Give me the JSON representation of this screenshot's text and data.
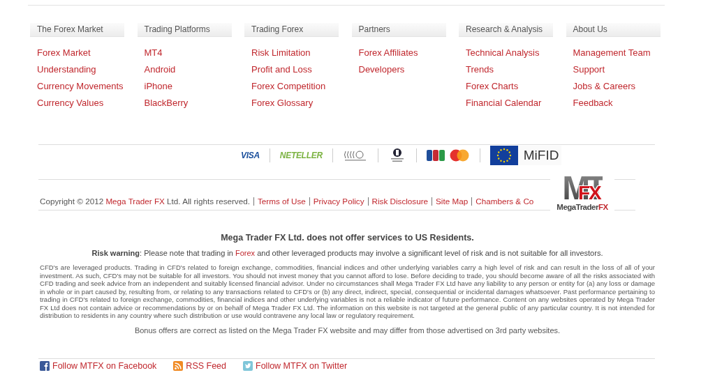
{
  "nav_columns": [
    {
      "heading": "The Forex Market",
      "links": [
        "Forex Market",
        "Understanding",
        "Currency Movements",
        "Currency Values"
      ]
    },
    {
      "heading": "Trading Platforms",
      "links": [
        "MT4",
        "Android",
        "iPhone",
        "BlackBerry"
      ]
    },
    {
      "heading": "Trading Forex",
      "links": [
        "Risk Limitation",
        "Profit and Loss",
        "Forex Competition",
        "Forex Glossary"
      ]
    },
    {
      "heading": "Partners",
      "links": [
        "Forex Affiliates",
        "Developers"
      ]
    },
    {
      "heading": "Research & Analysis",
      "links": [
        "Technical Analysis",
        "Trends",
        "Forex Charts",
        "Financial Calendar"
      ]
    },
    {
      "heading": "About Us",
      "links": [
        "Management Team",
        "Support",
        "Jobs & Careers",
        "Feedback"
      ]
    }
  ],
  "payment_logos": [
    {
      "kind": "wordmark",
      "text": "VISA",
      "color": "#1a4f9c"
    },
    {
      "kind": "wordmark",
      "text": "NETELLER",
      "color": "#7cb342"
    },
    {
      "kind": "rings"
    },
    {
      "kind": "disc"
    },
    {
      "kind": "tiles"
    },
    {
      "kind": "circles"
    },
    {
      "kind": "flag",
      "text": "MiFID"
    }
  ],
  "copyright": {
    "prefix": "Copyright © 2012 ",
    "company": "Mega Trader FX",
    "suffix": " Ltd. All rights reserved.",
    "links": [
      "Terms of Use",
      "Privacy Policy",
      "Risk Disclosure",
      "Site Map",
      "Chambers & Co"
    ]
  },
  "brand_logo": {
    "mark": "MT",
    "mark_accent": "FX",
    "wordmark": "MegaTrader",
    "wordmark_accent": "FX"
  },
  "us_notice": "Mega Trader FX Ltd. does not offer services to US Residents.",
  "risk_warning": {
    "label": "Risk warning",
    "before": ": Please note that trading in ",
    "link": "Forex",
    "after": " and other leveraged products may involve a significant level of risk and is not suitable for all investors."
  },
  "disclaimer": "CFD's are leveraged products. Trading in CFD's related to foreign exchange, commodities, financial indices and other underlying variables carry a high level of risk and can result in the loss of all of your investment. As such, CFD's may not be suitable for all investors. You should not invest money that you cannot afford to lose. Before deciding to trade, you should become aware of all the risks associated with CFD trading and seek advice from an independent and suitably licensed financial advisor. Under no circumstances shall Mega Trader FX Ltd have any liability to any person or entity for (a) any loss or damage in whole or in part caused by, resulting from, or relating to any transactions related to CFD's or (b) any direct, indirect, special, consequential or incidental damages whatsoever. Past performance pertaining to trading in CFD's related to foreign exchange, commodities, financial indices and other underlying variables is not a reliable indicator of future performance. Content on any websites operated by Mega Trader FX Ltd does not contain advice or recommendations by or on behalf of Mega Trader FX Ltd. The information on this website is not targeted at the general public of any particular country. It is not intended for distribution to residents in any country where such distribution or use would contravene any local law or regulatory requirement.",
  "bonus_note": "Bonus offers are correct as listed on the Mega Trader FX website and may differ from those advertised on 3rd party websites.",
  "social_links": [
    {
      "kind": "facebook",
      "label": "Follow MTFX on Facebook"
    },
    {
      "kind": "rss",
      "label": "RSS Feed"
    },
    {
      "kind": "twitter",
      "label": "Follow MTFX on Twitter"
    }
  ]
}
